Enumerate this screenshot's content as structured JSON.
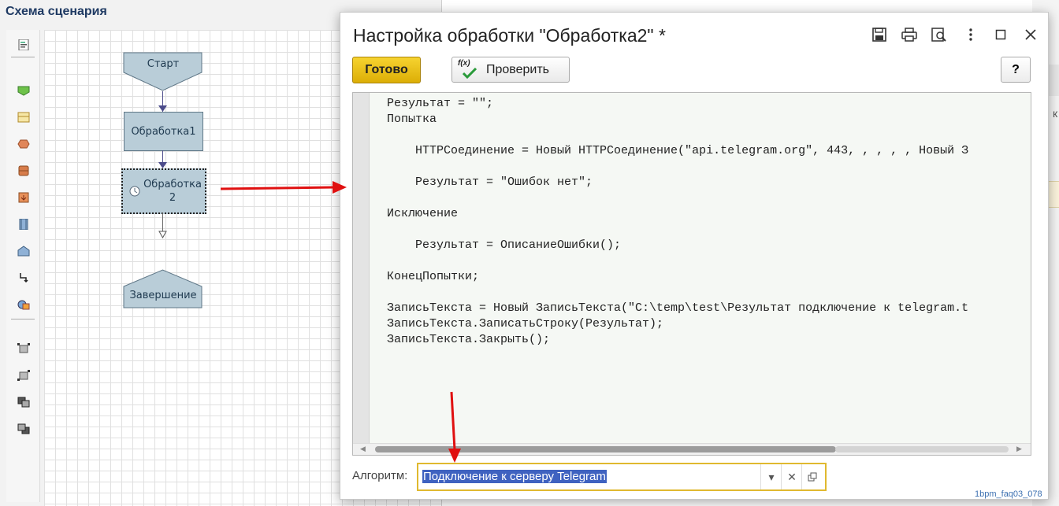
{
  "schema": {
    "title": "Схема сценария",
    "nodes": {
      "start": "Старт",
      "proc1": "Обработка1",
      "proc2_line1": "Обработка",
      "proc2_line2": "2",
      "end": "Завершение"
    }
  },
  "dialog": {
    "title": "Настройка обработки \"Обработка2\" *",
    "done_label": "Готово",
    "check_label": "Проверить",
    "check_icon_text": "f(x)",
    "help_label": "?",
    "code": "Результат = \"\";\nПопытка\n\n    HTTPСоединение = Новый HTTPСоединение(\"api.telegram.org\", 443, , , , , Новый З\n\n    Результат = \"Ошибок нет\";\n\nИсключение\n\n    Результат = ОписаниеОшибки();\n\nКонецПопытки;\n\nЗаписьТекста = Новый ЗаписьТекста(\"C:\\temp\\test\\Результат подключение к telegram.t\nЗаписьТекста.ЗаписатьСтроку(Результат);\nЗаписьТекста.Закрыть();",
    "algorithm_label": "Алгоритм:",
    "algorithm_value": "Подключение к серверу Telegram"
  },
  "right_peek": "к",
  "watermark": "1bpm_faq03_078",
  "colors": {
    "done_button": "#e8c21a",
    "annotation_arrow": "#e01010",
    "node_fill": "#b9cdd8",
    "field_focus": "#e0b92f",
    "selection": "#3f62c0"
  }
}
